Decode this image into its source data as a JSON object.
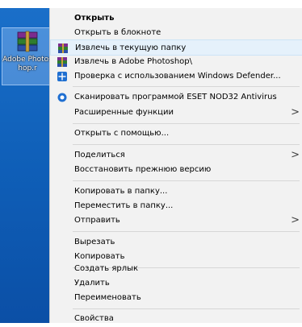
{
  "desktop": {
    "icon_label": "Adobe Photoshop.r",
    "icon_name": "winrar-archive-icon"
  },
  "menu": {
    "items": [
      {
        "label": "Открыть",
        "bold": true
      },
      {
        "label": "Открыть в блокноте"
      },
      {
        "label": "Извлечь в текущую папку",
        "icon": "winrar-icon"
      },
      {
        "label": "Извлечь в Adobe Photoshop\\",
        "icon": "winrar-icon"
      },
      {
        "label": "Проверка с использованием Windows Defender...",
        "icon": "windows-defender-icon"
      },
      {
        "label": "Сканировать программой ESET NOD32 Antivirus",
        "icon": "eset-icon"
      },
      {
        "label": "Расширенные функции",
        "submenu": true
      },
      {
        "label": "Открыть с помощью..."
      },
      {
        "label": "Поделиться",
        "submenu": true
      },
      {
        "label": "Восстановить прежнюю версию"
      },
      {
        "label": "Копировать в папку..."
      },
      {
        "label": "Переместить в папку..."
      },
      {
        "label": "Отправить",
        "submenu": true
      },
      {
        "label": "Вырезать"
      },
      {
        "label": "Копировать"
      },
      {
        "label": "Создать ярлык"
      },
      {
        "label": "Удалить"
      },
      {
        "label": "Переименовать"
      },
      {
        "label": "Свойства"
      }
    ],
    "submenu_arrow": ">"
  },
  "colors": {
    "menu_bg": "#f2f2f2",
    "hover_bg": "#e5f1fb",
    "desktop_blue": "#0f5fb8"
  }
}
